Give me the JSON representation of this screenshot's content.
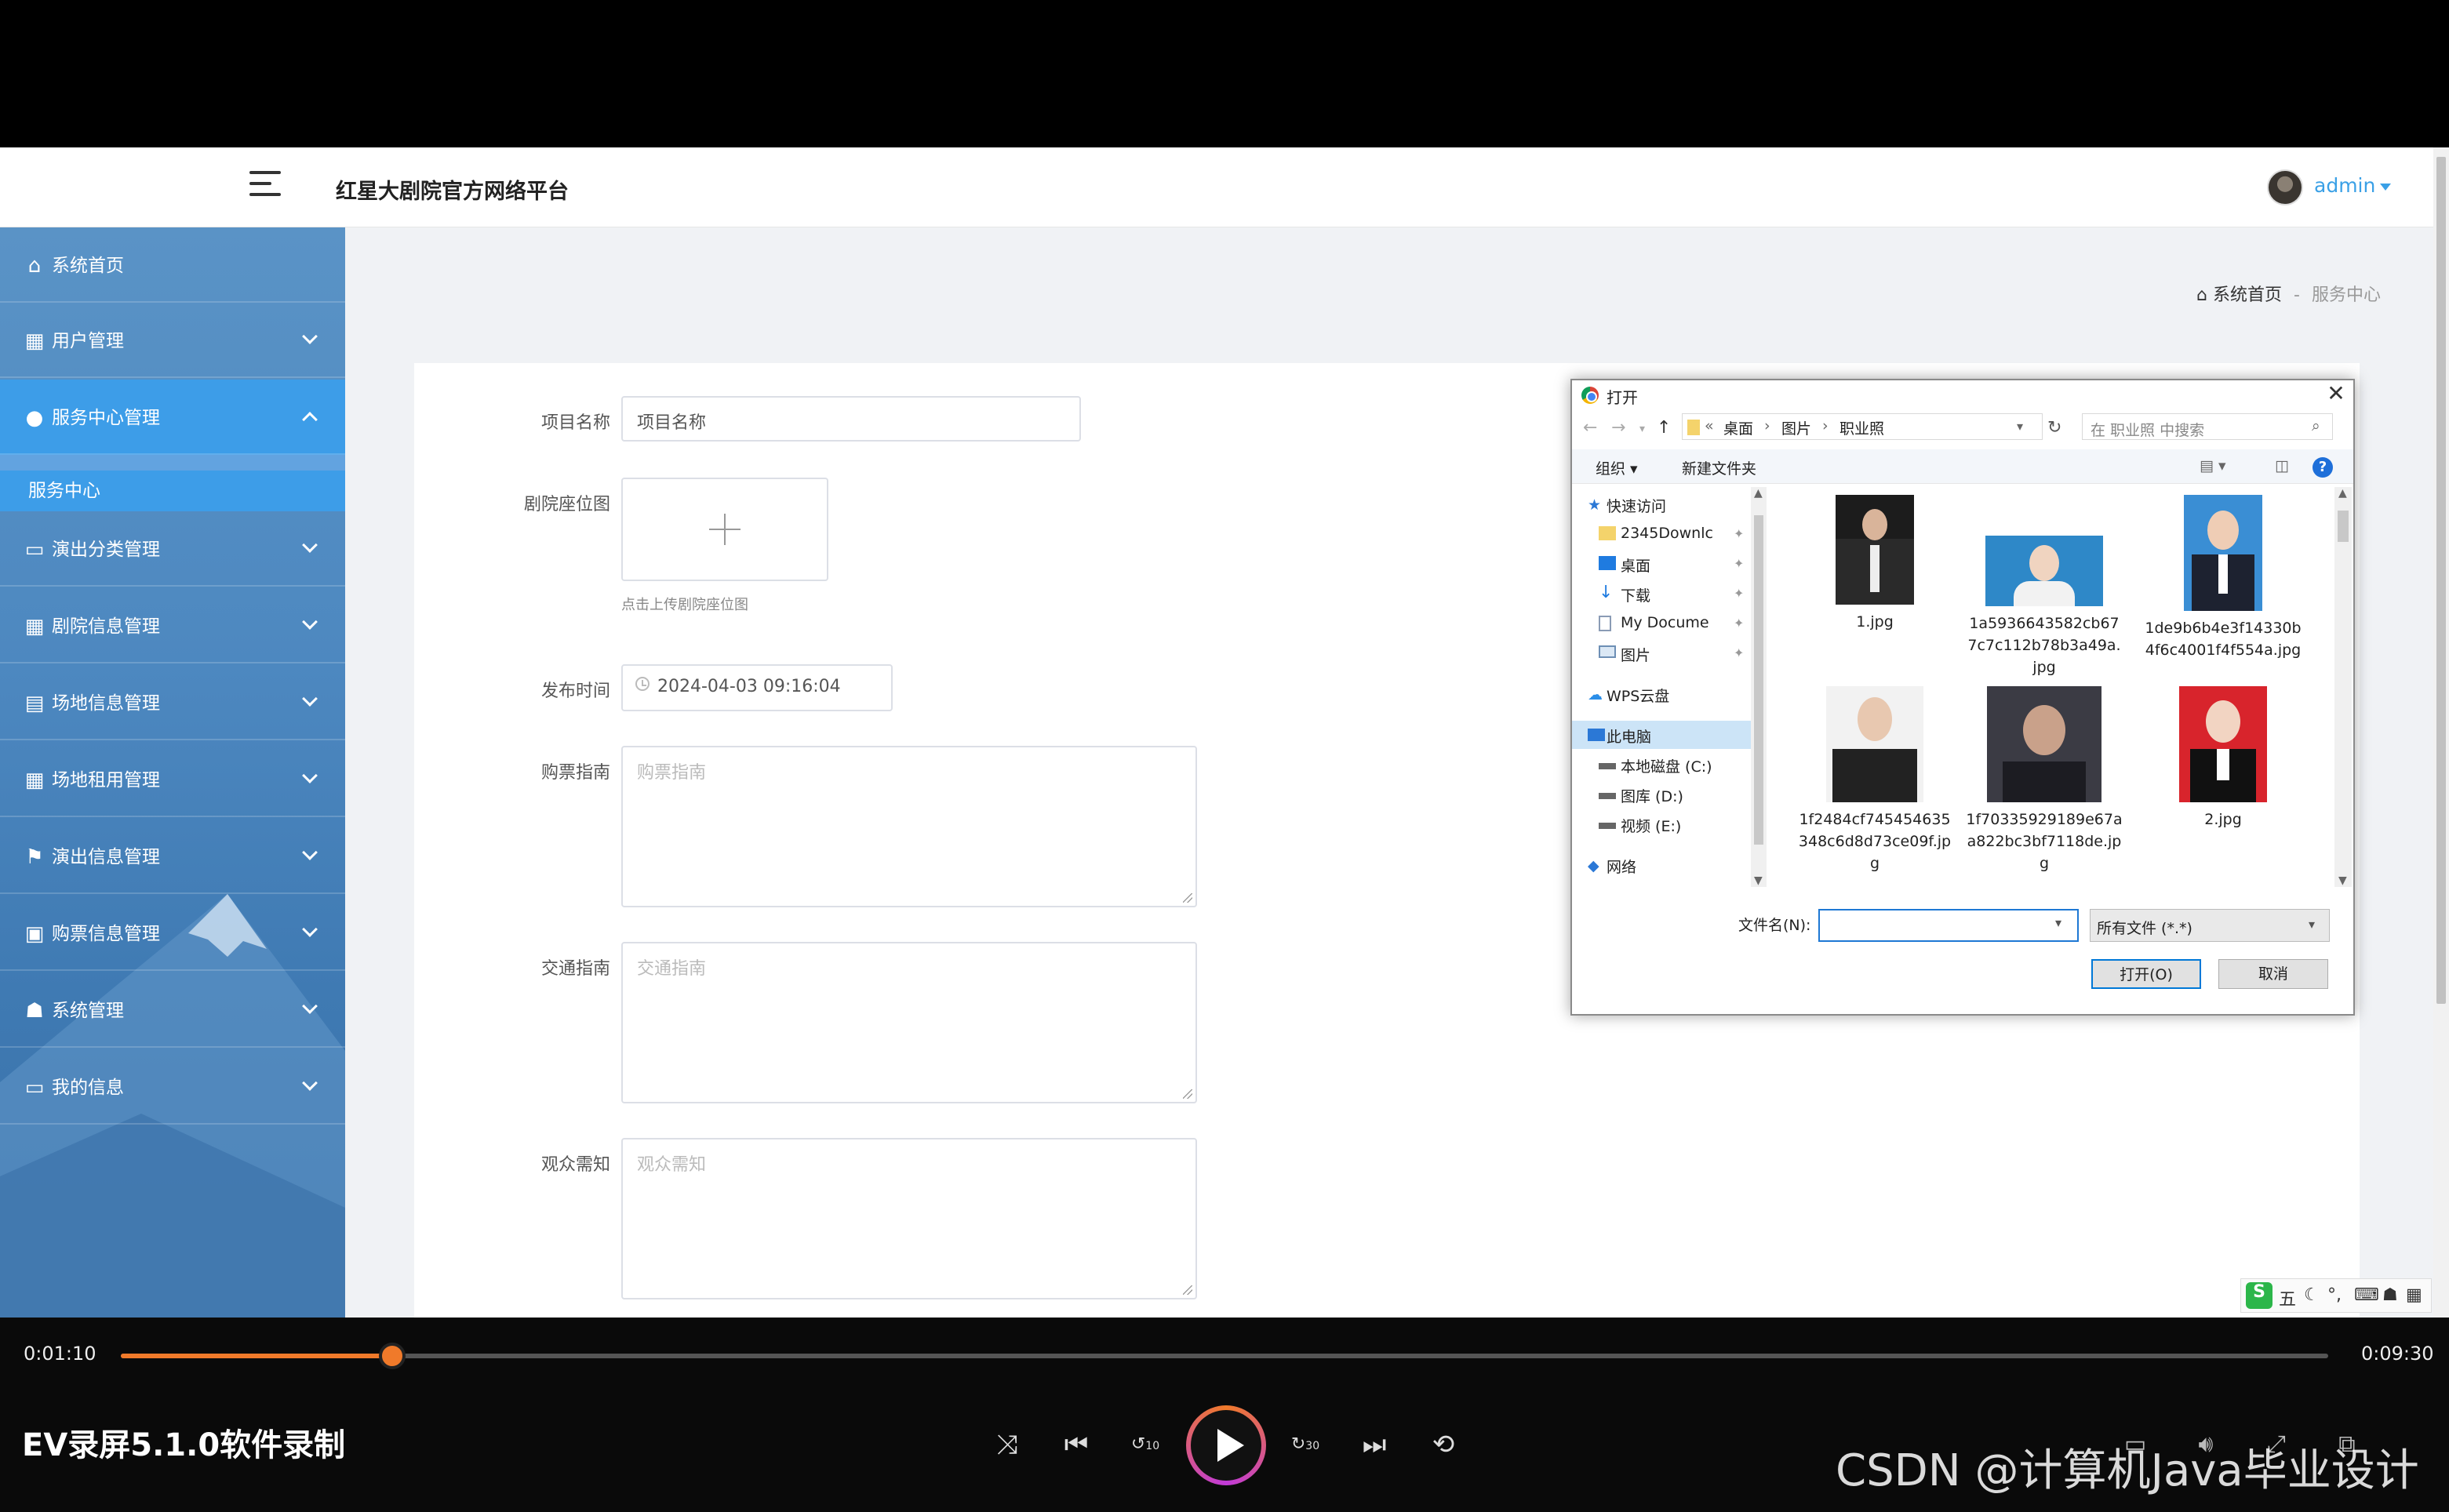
{
  "header": {
    "site_title": "红星大剧院官方网络平台",
    "user": "admin"
  },
  "sidebar": {
    "items": [
      {
        "label": "系统首页",
        "icon": "home-icon"
      },
      {
        "label": "用户管理",
        "icon": "grid-icon"
      },
      {
        "label": "服务中心管理",
        "icon": "bulb-icon"
      },
      {
        "label": "演出分类管理",
        "icon": "monitor-icon"
      },
      {
        "label": "剧院信息管理",
        "icon": "grid-icon"
      },
      {
        "label": "场地信息管理",
        "icon": "clipboard-icon"
      },
      {
        "label": "场地租用管理",
        "icon": "table-icon"
      },
      {
        "label": "演出信息管理",
        "icon": "flag-icon"
      },
      {
        "label": "购票信息管理",
        "icon": "briefcase-icon"
      },
      {
        "label": "系统管理",
        "icon": "user-icon"
      },
      {
        "label": "我的信息",
        "icon": "card-icon"
      }
    ],
    "sub_selected": "服务中心"
  },
  "breadcrumb": {
    "home": "系统首页",
    "sep": "-",
    "current": "服务中心"
  },
  "form": {
    "name_label": "项目名称",
    "name_value": "项目名称",
    "seat_label": "剧院座位图",
    "seat_hint": "点击上传剧院座位图",
    "time_label": "发布时间",
    "time_value": "2024-04-03 09:16:04",
    "ticket_label": "购票指南",
    "ticket_placeholder": "购票指南",
    "traffic_label": "交通指南",
    "traffic_placeholder": "交通指南",
    "audience_label": "观众需知",
    "audience_placeholder": "观众需知"
  },
  "dialog": {
    "title": "打开",
    "path": [
      "桌面",
      "图片",
      "职业照"
    ],
    "search_placeholder": "在 职业照 中搜索",
    "organize": "组织 ▾",
    "new_folder": "新建文件夹",
    "tree": [
      {
        "label": "快速访问"
      },
      {
        "label": "2345Downlc"
      },
      {
        "label": "桌面"
      },
      {
        "label": "下载"
      },
      {
        "label": "My Docume"
      },
      {
        "label": "图片"
      },
      {
        "label": "WPS云盘"
      },
      {
        "label": "此电脑"
      },
      {
        "label": "本地磁盘 (C:)"
      },
      {
        "label": "图库 (D:)"
      },
      {
        "label": "视频 (E:)"
      },
      {
        "label": "网络"
      }
    ],
    "files": [
      {
        "name": "1.jpg"
      },
      {
        "name": "1a5936643582cb677c7c112b78b3a49a.jpg"
      },
      {
        "name": "1de9b6b4e3f14330b4f6c4001f4f554a.jpg"
      },
      {
        "name": "1f2484cf745454635348c6d8d73ce09f.jpg"
      },
      {
        "name": "1f70335929189e67aa822bc3bf7118de.jpg"
      },
      {
        "name": "2.jpg"
      }
    ],
    "filename_label": "文件名(N):",
    "filename_value": "",
    "filetype": "所有文件 (*.*)",
    "open_btn": "打开(O)",
    "cancel_btn": "取消"
  },
  "ime": {
    "mode": "五"
  },
  "player": {
    "current_time": "0:01:10",
    "total_time": "0:09:30",
    "progress": 0.123,
    "title": "EV录屏5.1.0软件录制",
    "watermark": "CSDN @计算机Java毕业设计",
    "skip_back": "10",
    "skip_fwd": "30"
  }
}
